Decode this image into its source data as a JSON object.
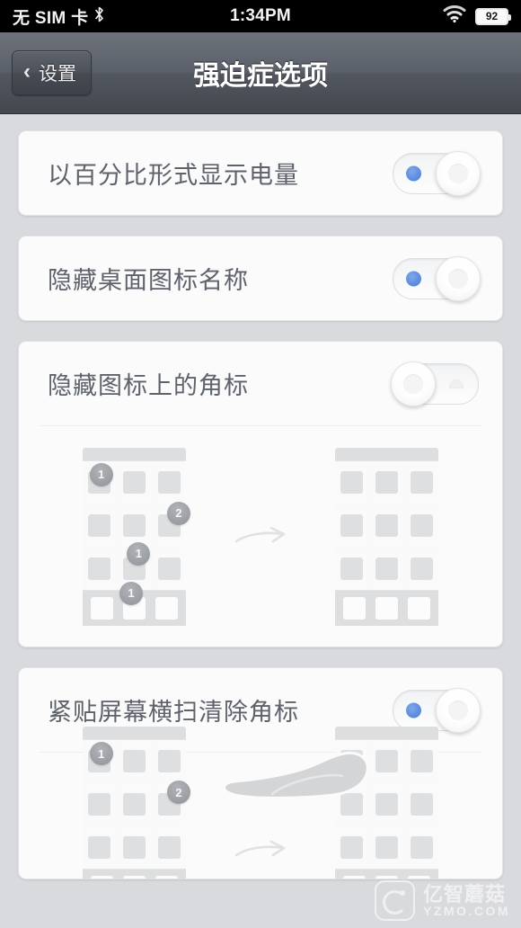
{
  "statusbar": {
    "carrier": "无 SIM 卡",
    "bluetooth_icon": "bluetooth-icon",
    "time": "1:34PM",
    "wifi_icon": "wifi-icon",
    "battery_level": "92"
  },
  "navbar": {
    "back_label": "设置",
    "back_chevron": "‹",
    "title": "强迫症选项"
  },
  "settings": [
    {
      "label": "以百分比形式显示电量",
      "toggle_state": "on"
    },
    {
      "label": "隐藏桌面图标名称",
      "toggle_state": "on"
    },
    {
      "label": "隐藏图标上的角标",
      "toggle_state": "off",
      "illustration": {
        "before_badges": [
          "1",
          "2",
          "1",
          "1"
        ],
        "arrow": "arrow-right-icon"
      }
    },
    {
      "label": "紧贴屏幕横扫清除角标",
      "toggle_state": "on",
      "illustration": {
        "before_badges": [
          "1",
          "2"
        ],
        "arrow": "arrow-right-icon",
        "hand": "hand-swipe-icon"
      }
    }
  ],
  "watermark": {
    "cn": "亿智蘑菇",
    "en": "YZMO.COM"
  },
  "colors": {
    "accent_blue": "#5b8de0",
    "page_bg": "#d8dadd",
    "card_bg": "#fbfbfb",
    "label_text": "#5d626b",
    "navbar_dark": "#52575f"
  }
}
